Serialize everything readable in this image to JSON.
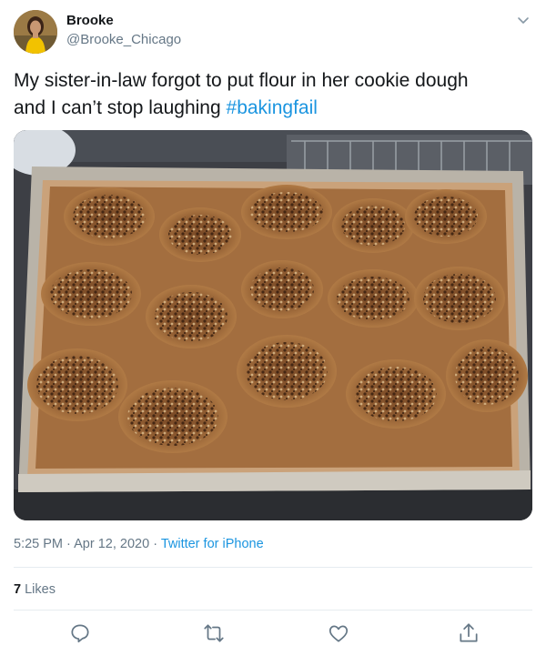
{
  "user": {
    "name": "Brooke",
    "handle": "@Brooke_Chicago"
  },
  "tweet": {
    "text_line1": "My sister-in-law forgot to put flour in her cookie dough",
    "text_line2": "and I can’t stop laughing ",
    "hashtag": "#bakingfail"
  },
  "meta": {
    "time": "5:25 PM",
    "date": "Apr 12, 2020",
    "source": "Twitter for iPhone",
    "sep": "·"
  },
  "stats": {
    "likes_count": "7",
    "likes_label": "Likes"
  },
  "colors": {
    "link": "#1b95e0",
    "muted": "#657786",
    "text": "#14171a",
    "divider": "#e6ecf0"
  },
  "icons": [
    "chevron-down-icon",
    "reply-icon",
    "retweet-icon",
    "like-icon",
    "share-icon"
  ]
}
